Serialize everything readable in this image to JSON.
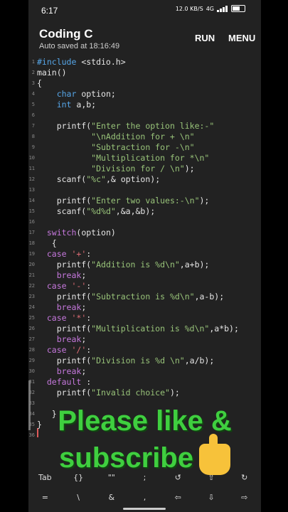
{
  "status": {
    "time": "6:17",
    "speed": "12.0 KB/S",
    "net": "4G"
  },
  "app": {
    "title": "Coding C",
    "subtitle": "Auto saved at 18:16:49",
    "run": "RUN",
    "menu": "MENU"
  },
  "code": [
    {
      "n": "1",
      "t": [
        [
          "pp",
          "#include"
        ],
        [
          "p",
          " <stdio.h>"
        ]
      ]
    },
    {
      "n": "2",
      "t": [
        [
          "p",
          "main()"
        ]
      ]
    },
    {
      "n": "3",
      "t": [
        [
          "p",
          "{"
        ]
      ]
    },
    {
      "n": "4",
      "t": [
        [
          "p",
          "    "
        ],
        [
          "ty",
          "char"
        ],
        [
          "p",
          " option;"
        ]
      ]
    },
    {
      "n": "5",
      "t": [
        [
          "p",
          "    "
        ],
        [
          "ty",
          "int"
        ],
        [
          "p",
          " a,b;"
        ]
      ]
    },
    {
      "n": "6",
      "t": [
        [
          "p",
          ""
        ]
      ]
    },
    {
      "n": "7",
      "t": [
        [
          "p",
          "    printf("
        ],
        [
          "st",
          "\"Enter the option like:-\""
        ]
      ]
    },
    {
      "n": "8",
      "t": [
        [
          "st",
          "           \"\\nAddition for + \\n\""
        ]
      ]
    },
    {
      "n": "9",
      "t": [
        [
          "st",
          "           \"Subtraction for -\\n\""
        ]
      ]
    },
    {
      "n": "10",
      "t": [
        [
          "st",
          "           \"Multiplication for *\\n\""
        ]
      ]
    },
    {
      "n": "11",
      "t": [
        [
          "st",
          "           \"Division for / \\n\""
        ],
        [
          "p",
          ");"
        ]
      ]
    },
    {
      "n": "12",
      "t": [
        [
          "p",
          "    scanf("
        ],
        [
          "st",
          "\"%c\""
        ],
        [
          "p",
          ",& option);"
        ]
      ]
    },
    {
      "n": "13",
      "t": [
        [
          "p",
          ""
        ]
      ]
    },
    {
      "n": "14",
      "t": [
        [
          "p",
          "    printf("
        ],
        [
          "st",
          "\"Enter two values:-\\n\""
        ],
        [
          "p",
          ");"
        ]
      ]
    },
    {
      "n": "15",
      "t": [
        [
          "p",
          "    scanf("
        ],
        [
          "st",
          "\"%d%d\""
        ],
        [
          "p",
          ",&a,&b);"
        ]
      ]
    },
    {
      "n": "16",
      "t": [
        [
          "p",
          ""
        ]
      ]
    },
    {
      "n": "17",
      "t": [
        [
          "p",
          "  "
        ],
        [
          "kw",
          "switch"
        ],
        [
          "p",
          "(option)"
        ]
      ]
    },
    {
      "n": "18",
      "t": [
        [
          "p",
          "   {"
        ]
      ]
    },
    {
      "n": "19",
      "t": [
        [
          "p",
          "  "
        ],
        [
          "kw",
          "case"
        ],
        [
          "p",
          " "
        ],
        [
          "ch",
          "'+'"
        ],
        [
          "p",
          ":"
        ]
      ]
    },
    {
      "n": "20",
      "t": [
        [
          "p",
          "    printf("
        ],
        [
          "st",
          "\"Addition is %d\\n\""
        ],
        [
          "p",
          ",a+b);"
        ]
      ]
    },
    {
      "n": "21",
      "t": [
        [
          "p",
          "    "
        ],
        [
          "kw",
          "break"
        ],
        [
          "p",
          ";"
        ]
      ]
    },
    {
      "n": "22",
      "t": [
        [
          "p",
          "  "
        ],
        [
          "kw",
          "case"
        ],
        [
          "p",
          " "
        ],
        [
          "ch",
          "'-'"
        ],
        [
          "p",
          ":"
        ]
      ]
    },
    {
      "n": "23",
      "t": [
        [
          "p",
          "    printf("
        ],
        [
          "st",
          "\"Subtraction is %d\\n\""
        ],
        [
          "p",
          ",a-b);"
        ]
      ]
    },
    {
      "n": "24",
      "t": [
        [
          "p",
          "    "
        ],
        [
          "kw",
          "break"
        ],
        [
          "p",
          ";"
        ]
      ]
    },
    {
      "n": "25",
      "t": [
        [
          "p",
          "  "
        ],
        [
          "kw",
          "case"
        ],
        [
          "p",
          " "
        ],
        [
          "ch",
          "'*'"
        ],
        [
          "p",
          ":"
        ]
      ]
    },
    {
      "n": "26",
      "t": [
        [
          "p",
          "    printf("
        ],
        [
          "st",
          "\"Multiplication is %d\\n\""
        ],
        [
          "p",
          ",a*b);"
        ]
      ]
    },
    {
      "n": "27",
      "t": [
        [
          "p",
          "    "
        ],
        [
          "kw",
          "break"
        ],
        [
          "p",
          ";"
        ]
      ]
    },
    {
      "n": "28",
      "t": [
        [
          "p",
          "  "
        ],
        [
          "kw",
          "case"
        ],
        [
          "p",
          " "
        ],
        [
          "ch",
          "'/'"
        ],
        [
          "p",
          ":"
        ]
      ]
    },
    {
      "n": "29",
      "t": [
        [
          "p",
          "    printf("
        ],
        [
          "st",
          "\"Division is %d \\n\""
        ],
        [
          "p",
          ",a/b);"
        ]
      ]
    },
    {
      "n": "30",
      "t": [
        [
          "p",
          "    "
        ],
        [
          "kw",
          "break"
        ],
        [
          "p",
          ";"
        ]
      ]
    },
    {
      "n": "31",
      "t": [
        [
          "p",
          "  "
        ],
        [
          "kw",
          "default"
        ],
        [
          "p",
          " :"
        ]
      ]
    },
    {
      "n": "32",
      "t": [
        [
          "p",
          "    printf("
        ],
        [
          "st",
          "\"Invalid choice\""
        ],
        [
          "p",
          ");"
        ]
      ]
    },
    {
      "n": "33",
      "t": [
        [
          "p",
          ""
        ]
      ]
    },
    {
      "n": "34",
      "t": [
        [
          "p",
          "   }"
        ]
      ]
    },
    {
      "n": "35",
      "t": [
        [
          "p",
          "}"
        ]
      ]
    },
    {
      "n": "36",
      "t": [
        [
          "p",
          ""
        ]
      ]
    }
  ],
  "overlay": {
    "line1": "Please like &",
    "line2": "subscribe"
  },
  "keys_row1": [
    "Tab",
    "{}",
    "\"\"",
    ";",
    "↺",
    "⇧",
    "↻"
  ],
  "keys_row2": [
    "=",
    "\\",
    "&",
    ",",
    "⇦",
    "⇩",
    "⇨"
  ],
  "colors": {
    "keyword": "#c678dd",
    "type": "#56a6e8",
    "string": "#98c379",
    "char": "#e06c75",
    "overlay_text": "#3fcf3f"
  }
}
